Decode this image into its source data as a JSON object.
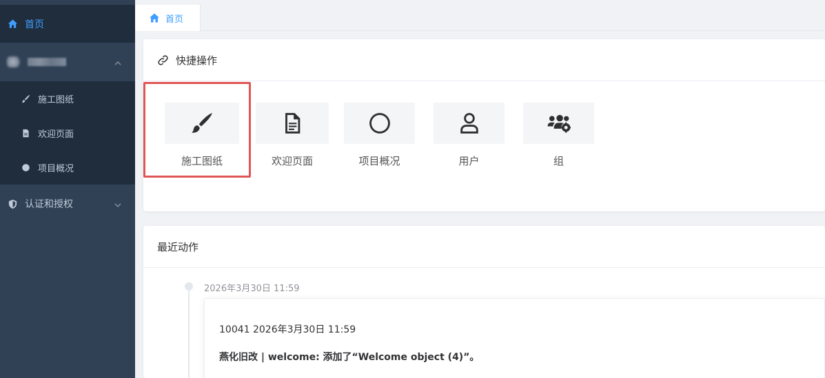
{
  "sidebar": {
    "home_label": "首页",
    "group_label": "",
    "submenu": [
      {
        "label": "施工图纸",
        "icon": "brush-icon"
      },
      {
        "label": "欢迎页面",
        "icon": "file-icon"
      },
      {
        "label": "项目概况",
        "icon": "circle-icon"
      }
    ],
    "auth_label": "认证和授权"
  },
  "tags": {
    "home": "首页"
  },
  "quick": {
    "title": "快捷操作",
    "shortcuts": [
      {
        "label": "施工图纸",
        "icon": "brush-icon"
      },
      {
        "label": "欢迎页面",
        "icon": "file-lines-icon"
      },
      {
        "label": "项目概况",
        "icon": "circle-icon"
      },
      {
        "label": "用户",
        "icon": "user-icon"
      },
      {
        "label": "组",
        "icon": "users-gear-icon"
      }
    ]
  },
  "recent": {
    "title": "最近动作",
    "entries": [
      {
        "time": "2026年3月30日 11:59",
        "title": "10041 2026年3月30日 11:59",
        "desc": "燕化旧改 | welcome: 添加了“Welcome object (4)”。"
      }
    ]
  },
  "colors": {
    "sidebar_bg": "#304156",
    "sidebar_active_bg": "#1f2d3d",
    "accent": "#409eff",
    "highlight": "#e05555"
  }
}
